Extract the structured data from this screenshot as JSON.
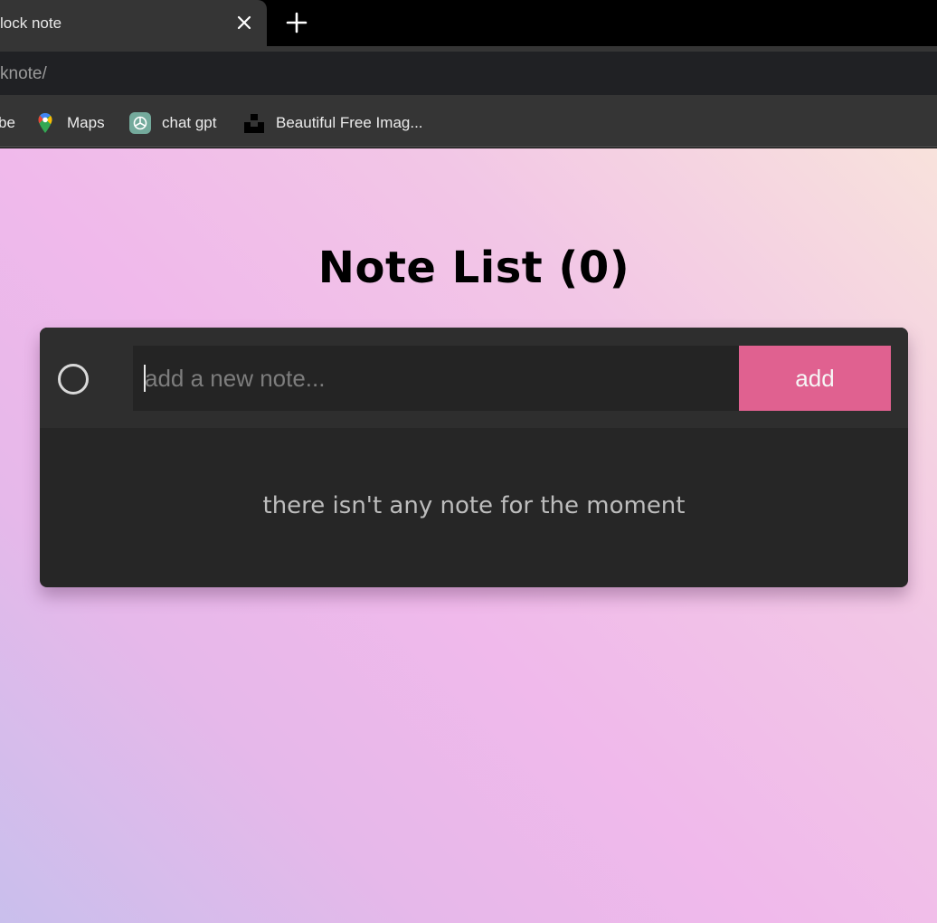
{
  "browser": {
    "tab": {
      "title": "lock note"
    },
    "address_bar": {
      "url_text": "knote/"
    },
    "bookmarks": [
      {
        "label": "be",
        "icon": "partial-bookmark"
      },
      {
        "label": "Maps",
        "icon": "google-maps-icon"
      },
      {
        "label": "chat gpt",
        "icon": "chatgpt-icon"
      },
      {
        "label": "Beautiful Free Imag...",
        "icon": "unsplash-icon"
      }
    ]
  },
  "app": {
    "title": "Note List (0)",
    "input": {
      "placeholder": "add a new note...",
      "value": ""
    },
    "add_button_label": "add",
    "empty_message": "there isn't any note for the moment",
    "colors": {
      "accent": "#e06190",
      "card_bg": "#262626",
      "input_row_bg": "#2e2e2e",
      "input_bg": "#242424"
    }
  }
}
